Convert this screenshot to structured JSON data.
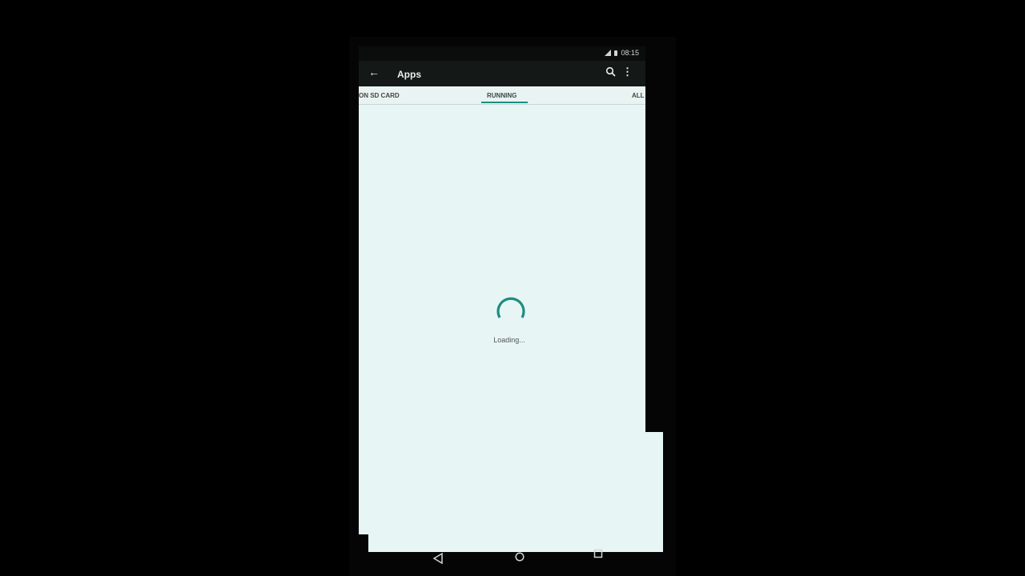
{
  "status_bar": {
    "time": "08:15"
  },
  "app_bar": {
    "title": "Apps"
  },
  "tabs": [
    {
      "label": "ON SD CARD",
      "selected": false
    },
    {
      "label": "RUNNING",
      "selected": true
    },
    {
      "label": "ALL",
      "selected": false
    }
  ],
  "content": {
    "loading_text": "Loading..."
  },
  "icons": {
    "back": "arrow-left-icon",
    "search": "search-icon",
    "more": "more-vert-icon",
    "nav_back": "nav-back-icon",
    "nav_home": "nav-home-icon",
    "nav_recent": "nav-recent-icon"
  },
  "colors": {
    "accent": "#1e8d82",
    "app_bar": "#141816",
    "background": "#e7f6f4"
  }
}
